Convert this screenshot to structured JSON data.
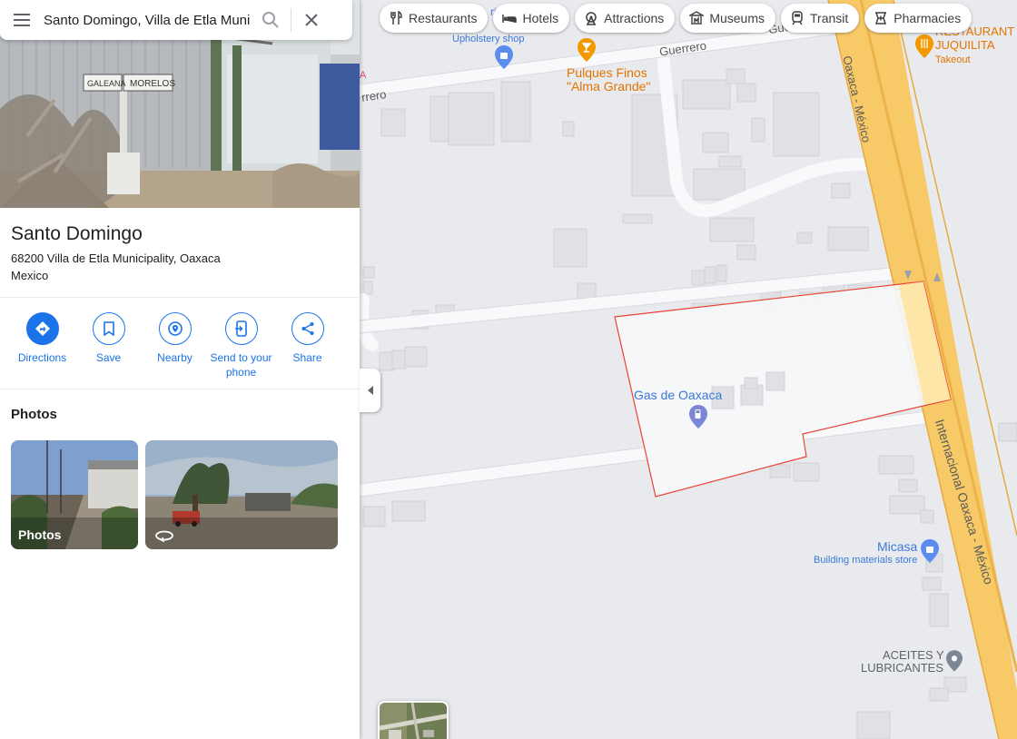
{
  "search": {
    "query": "Santo Domingo, Villa de Etla Municipality"
  },
  "place": {
    "name": "Santo Domingo",
    "address_line1": "68200 Villa de Etla Municipality, Oaxaca",
    "address_line2": "Mexico",
    "hero_sign_left": "GALEANA",
    "hero_sign_right": "MORELOS"
  },
  "actions": [
    {
      "label": "Directions",
      "icon": "directions-icon"
    },
    {
      "label": "Save",
      "icon": "bookmark-icon"
    },
    {
      "label": "Nearby",
      "icon": "nearby-icon"
    },
    {
      "label": "Send to your phone",
      "icon": "phone-icon"
    },
    {
      "label": "Share",
      "icon": "share-icon"
    }
  ],
  "photos": {
    "heading": "Photos",
    "tile1_caption": "Photos"
  },
  "chips": [
    {
      "label": "Restaurants",
      "icon": "fork-knife-icon"
    },
    {
      "label": "Hotels",
      "icon": "bed-icon"
    },
    {
      "label": "Attractions",
      "icon": "ferris-wheel-icon"
    },
    {
      "label": "Museums",
      "icon": "museum-icon"
    },
    {
      "label": "Transit",
      "icon": "train-icon"
    },
    {
      "label": "Pharmacies",
      "icon": "pharmacy-icon"
    }
  ],
  "map": {
    "upholstery_label": "Upholstery shop",
    "upholstery_top": "ri",
    "pulques_line1": "Pulques Finos",
    "pulques_line2": "\"Alma Grande\"",
    "juquilita_line1": "RESTAURANT",
    "juquilita_line2": "JUQUILITA",
    "juquilita_sub": "Takeout",
    "gas_label": "Gas de Oaxaca",
    "micasa_label": "Micasa",
    "micasa_sub": "Building materials store",
    "aceites_line1": "ACEITES Y",
    "aceites_line2": "LUBRICANTES",
    "road_guerrero_1": "Guerrero",
    "road_guerrero_2": "rrero",
    "road_guerrero_3": "Guerrer",
    "highway_top": "Oaxaca - México",
    "highway_bottom": "Internacional Oaxaca - México",
    "corner_a": "A"
  },
  "colors": {
    "accent": "#1a73e8",
    "highway": "#f8c967",
    "highlight_outline": "#ea4335"
  }
}
